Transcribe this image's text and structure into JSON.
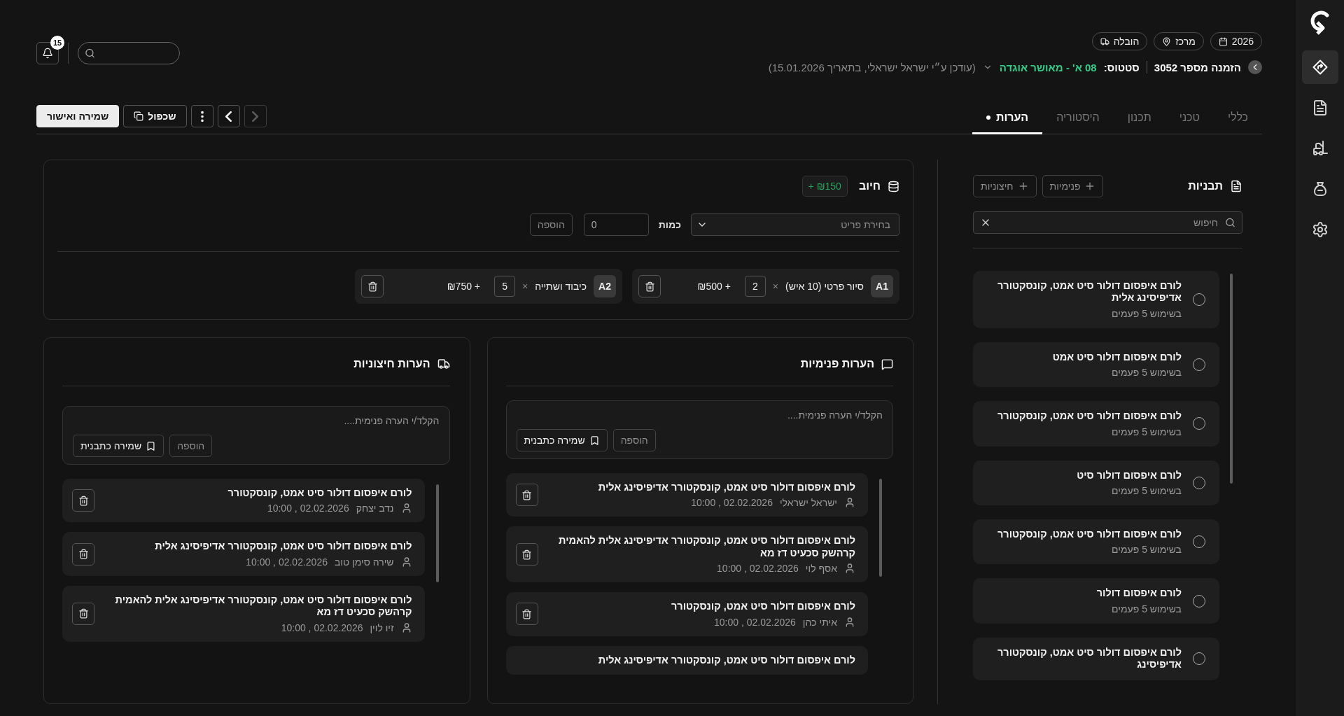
{
  "sidebar": {
    "items": [
      {
        "kind": "route",
        "selected": true
      },
      {
        "kind": "document",
        "selected": false
      },
      {
        "kind": "forklift",
        "selected": false
      },
      {
        "kind": "bag",
        "selected": false
      },
      {
        "kind": "settings",
        "selected": false
      }
    ]
  },
  "header": {
    "chips": [
      {
        "kind": "calendar",
        "label": "2026"
      },
      {
        "kind": "location",
        "label": "מרכז"
      },
      {
        "kind": "truck",
        "label": "הובלה"
      }
    ],
    "order": {
      "label": "הזמנה מספר 3052",
      "status_label": "סטטוס:",
      "status": "08 א' - מאושר אוגדה",
      "updated": "(עודכן ע״י ישראל ישראלי, בתאריך 15.01.2026)"
    },
    "notifications": {
      "count": "15"
    }
  },
  "tabs": [
    {
      "label": "כללי",
      "selected": false,
      "indicator": false
    },
    {
      "label": "טכני",
      "selected": false,
      "indicator": false
    },
    {
      "label": "תכנון",
      "selected": false,
      "indicator": false
    },
    {
      "label": "היסטוריה",
      "selected": false,
      "indicator": false
    },
    {
      "label": "הערות",
      "selected": true,
      "indicator": true
    }
  ],
  "toolbar": {
    "save": "שמירה ואישור",
    "duplicate": "שכפול",
    "nav": [
      {
        "kind": "prev",
        "disabled": false
      },
      {
        "kind": "next",
        "disabled": true
      }
    ]
  },
  "charge": {
    "title": "חיוב",
    "total": "+ ₪150",
    "item_select": {
      "placeholder": "בחירת פריט"
    },
    "quantity_label": "כמות",
    "quantity": "0",
    "add": {
      "label": "הוספה",
      "disabled": true
    },
    "items": [
      {
        "code": "A1",
        "name": "סיור פרטי (10 איש)",
        "times": "×",
        "qty": "2",
        "price": "₪500 +"
      },
      {
        "code": "A2",
        "name": "כיבוד ושתייה",
        "times": "×",
        "qty": "5",
        "price": "₪750 +"
      }
    ]
  },
  "internal_notes": {
    "title": "הערות פנימיות",
    "placeholder": "הקלד/י הערה פנימית....",
    "add": {
      "label": "הוספה",
      "disabled": true
    },
    "save_template": "שמירה כתבנית",
    "items": [
      {
        "title": "לורם איפסום דולור סיט אמט, קונסקטורר אדיפיסינג אלית",
        "author": "ישראל ישראלי",
        "date": "02.02.2026 , 10:00"
      },
      {
        "title": "לורם איפסום דולור סיט אמט, קונסקטורר אדיפיסינג אלית להאמית קרהשק סכעיט דז מא",
        "author": "אסף לוי",
        "date": "02.02.2026 , 10:00"
      },
      {
        "title": "לורם איפסום דולור סיט אמט, קונסקטורר",
        "author": "איתי כהן",
        "date": "02.02.2026 , 10:00"
      },
      {
        "title": "לורם איפסום דולור סיט אמט, קונסקטורר אדיפיסינג אלית"
      }
    ]
  },
  "external_notes": {
    "title": "הערות חיצוניות",
    "placeholder": "הקלד/י הערה פנימית....",
    "add": {
      "label": "הוספה",
      "disabled": true
    },
    "save_template": "שמירה כתבנית",
    "items": [
      {
        "title": "לורם איפסום דולור סיט אמט, קונסקטורר",
        "author": "נדב יצחק",
        "date": "02.02.2026 , 10:00"
      },
      {
        "title": "לורם איפסום דולור סיט אמט, קונסקטורר אדיפיסינג אלית",
        "author": "שירה סימן טוב",
        "date": "02.02.2026 , 10:00"
      },
      {
        "title": "לורם איפסום דולור סיט אמט, קונסקטורר אדיפיסינג אלית להאמית קרהשק סכעיט דז מא",
        "author": "זיו לוין",
        "date": "02.02.2026 , 10:00"
      }
    ]
  },
  "templates": {
    "title": "תבניות",
    "add_buttons": [
      "פנימיות",
      "חיצוניות"
    ],
    "search": {
      "placeholder": "חיפוש"
    },
    "items": [
      {
        "title": "לורם איפסום דולור סיט אמט, קונסקטורר אדיפיסינג אלית",
        "usage": "בשימוש 5 פעמים",
        "selected": false
      },
      {
        "title": "לורם איפסום דולור סיט אמט",
        "usage": "בשימוש 5 פעמים",
        "selected": false
      },
      {
        "title": "לורם איפסום דולור סיט אמט, קונסקטורר",
        "usage": "בשימוש 5 פעמים",
        "selected": false
      },
      {
        "title": "לורם איפסום דולור סיט",
        "usage": "בשימוש 5 פעמים",
        "selected": false
      },
      {
        "title": "לורם איפסום דולור סיט אמט, קונסקטורר",
        "usage": "בשימוש 5 פעמים",
        "selected": false
      },
      {
        "title": "לורם איפסום דולור",
        "usage": "בשימוש 5 פעמים",
        "selected": false
      },
      {
        "title": "לורם איפסום דולור סיט אמט, קונסקטורר אדיפיסינג",
        "selected": false
      }
    ]
  }
}
